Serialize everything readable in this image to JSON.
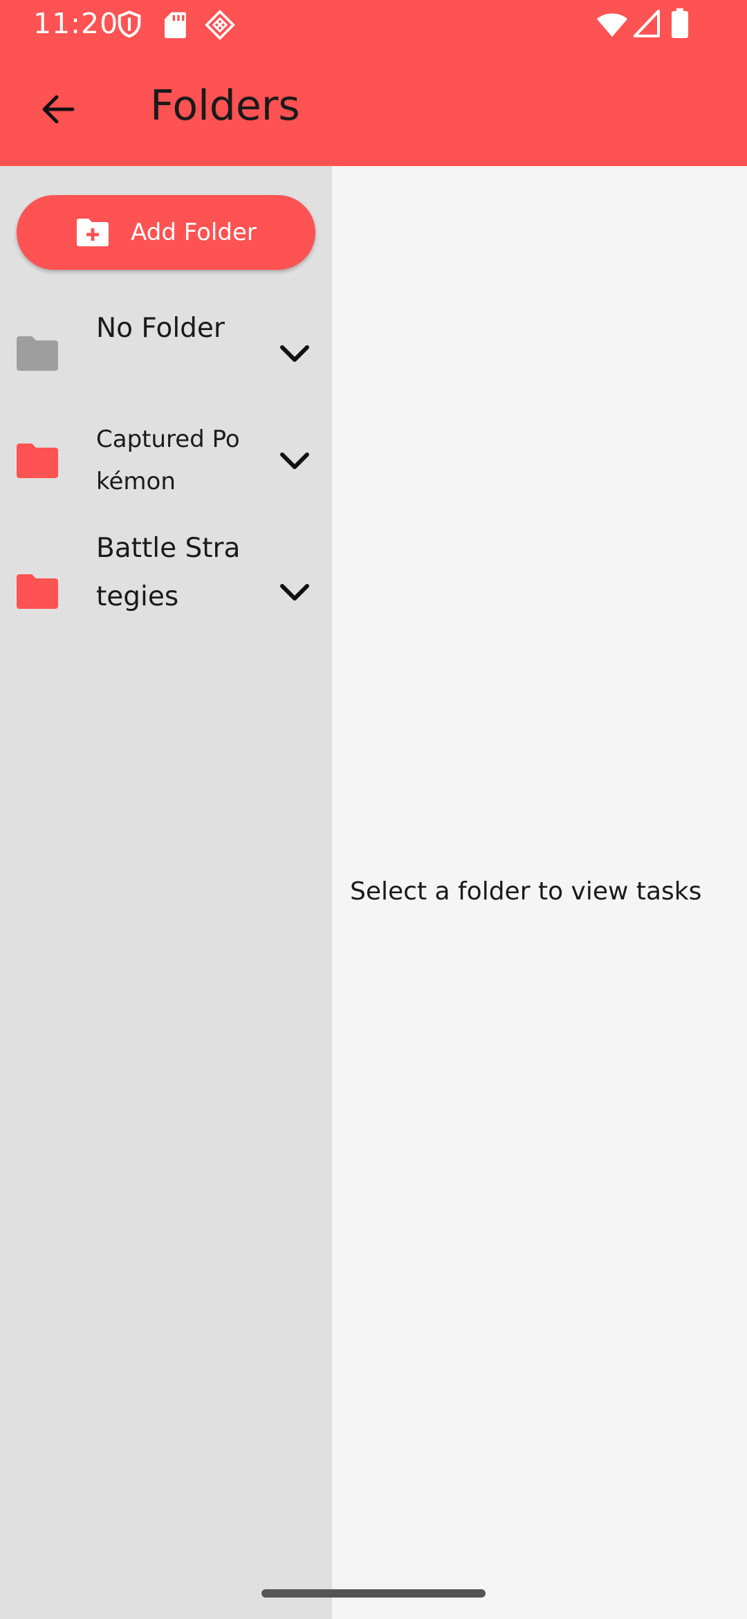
{
  "status_bar": {
    "time": "11:20",
    "icons": [
      "shield-icon",
      "sd-card-icon",
      "diamond-grid-icon",
      "wifi-icon",
      "signal-icon",
      "battery-icon"
    ]
  },
  "app_bar": {
    "title": "Folders",
    "back_icon": "arrow-back-icon"
  },
  "sidebar": {
    "add_button_label": "Add Folder",
    "folders": [
      {
        "label": "No Folder",
        "color": "#9e9e9e"
      },
      {
        "label": "Captured Pokémon",
        "color": "#ff5252"
      },
      {
        "label": "Battle Strategies",
        "color": "#ff5252"
      }
    ]
  },
  "main": {
    "empty_message": "Select a folder to view tasks"
  },
  "colors": {
    "accent": "#ff5252",
    "sidebar_bg": "#e0e0e0",
    "content_bg": "#f5f5f5"
  }
}
